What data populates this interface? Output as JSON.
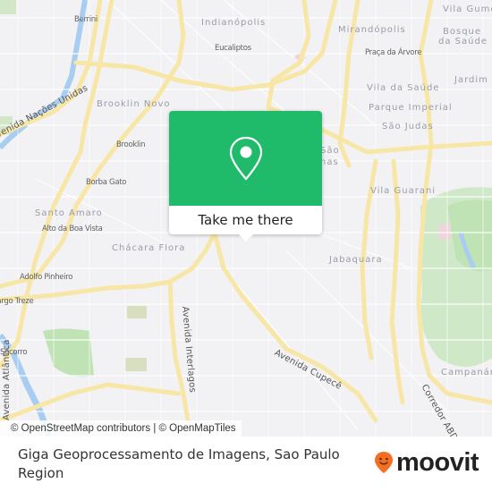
{
  "map": {
    "area_labels": [
      {
        "text": "Indianópolis"
      },
      {
        "text": "Mirandópolis"
      },
      {
        "text": "Vila Gume"
      },
      {
        "text": "Bosque"
      },
      {
        "text": "da Saúde"
      },
      {
        "text": "Jardim d"
      },
      {
        "text": "Brooklin Novo"
      },
      {
        "text": "Vila da Saúde"
      },
      {
        "text": "Parque Imperial"
      },
      {
        "text": "São Judas"
      },
      {
        "text": "Vila Guarani"
      },
      {
        "text": "Santo Amaro"
      },
      {
        "text": "Chácara Flora"
      },
      {
        "text": "Jabaquara"
      },
      {
        "text": "Campanár"
      },
      {
        "text": "São"
      },
      {
        "text": "nas"
      }
    ],
    "stop_labels": [
      {
        "text": "Berrini"
      },
      {
        "text": "Eucaliptos"
      },
      {
        "text": "Praça da Árvore"
      },
      {
        "text": "Brooklin"
      },
      {
        "text": "Borba Gato"
      },
      {
        "text": "Alto da Boa Vista"
      },
      {
        "text": "Adolfo Pinheiro"
      },
      {
        "text": "Largo Treze"
      },
      {
        "text": "Socorro"
      }
    ],
    "road_labels": [
      {
        "text": "Avenida Nações Unidas"
      },
      {
        "text": "Avenida Interlagos"
      },
      {
        "text": "Avenida Cupecê"
      },
      {
        "text": "Corredor ABD"
      },
      {
        "text": "Avenida Atlântica"
      }
    ],
    "attribution": "© OpenStreetMap contributors | © OpenMapTiles"
  },
  "popup": {
    "icon": "map-pin-icon",
    "button_label": "Take me there",
    "accent_color": "#1fba6a"
  },
  "footer": {
    "place_title": "Giga Geoprocessamento de Imagens, Sao Paulo Region",
    "logo_text": "moovit",
    "logo_color": "#f36f21"
  }
}
